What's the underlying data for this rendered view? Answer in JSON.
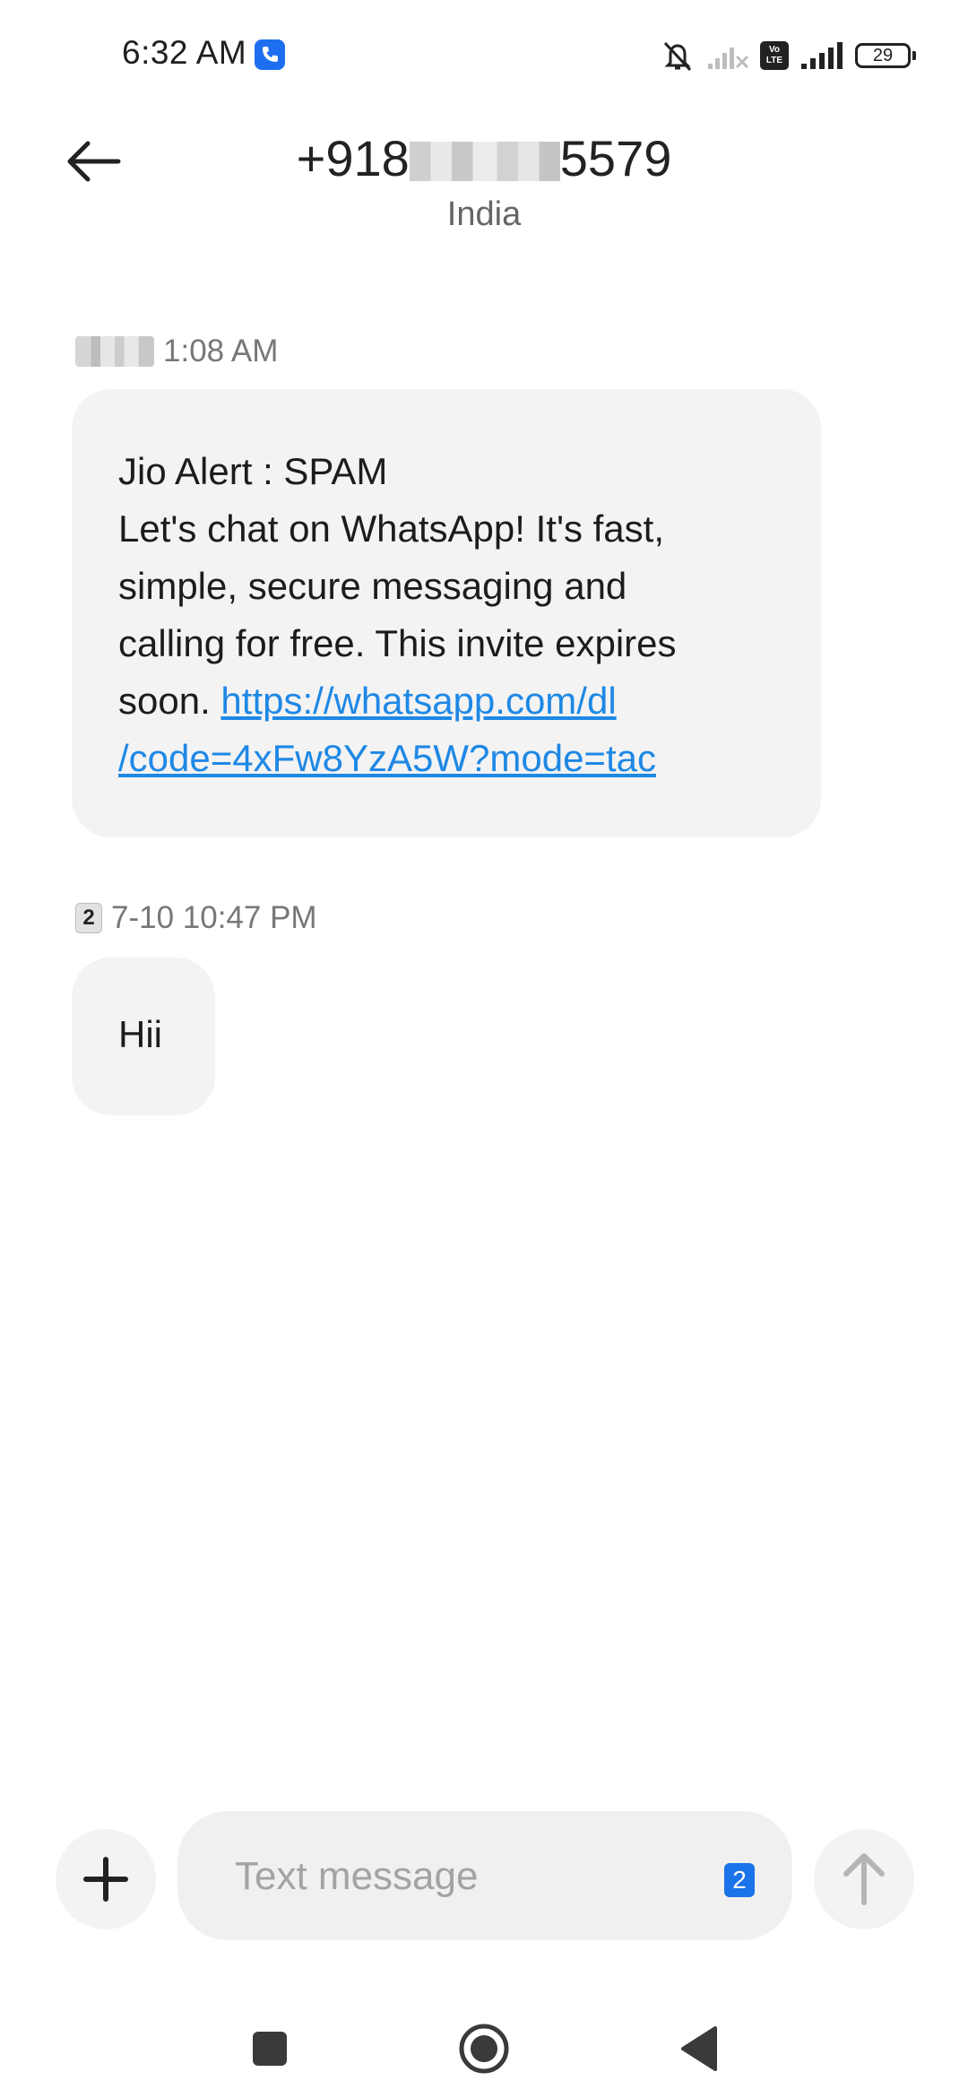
{
  "status_bar": {
    "time": "6:32 AM",
    "battery_level": "29",
    "volte_label_top": "Vo",
    "volte_label_bottom": "LTE",
    "icons": [
      "call-app-icon",
      "bell-muted-icon",
      "signal-no-service-icon",
      "volte-icon",
      "signal-icon",
      "battery-icon"
    ]
  },
  "header": {
    "back_icon": "arrow-left-icon",
    "title_prefix": "+918",
    "title_suffix": "5579",
    "subtitle": "India"
  },
  "messages": [
    {
      "timestamp": "1:08 AM",
      "sim_indicator": "blurred",
      "lines": [
        "Jio Alert : SPAM",
        "Let's chat on WhatsApp! It's fast,",
        "simple, secure messaging and",
        "calling for free. This invite expires"
      ],
      "link_lead": "soon. ",
      "link_line1": "https://whatsapp.com/dl",
      "link_line2": "/code=4xFw8YzA5W?mode=tac"
    },
    {
      "timestamp": "7-10 10:47 PM",
      "sim_indicator": "2",
      "text": "Hii"
    }
  ],
  "composer": {
    "attach_icon": "plus-icon",
    "placeholder": "Text message",
    "sim_label": "2",
    "send_icon": "arrow-up-icon"
  },
  "nav_bar": {
    "icons": [
      "recents-square-icon",
      "home-circle-icon",
      "back-triangle-icon"
    ]
  },
  "colors": {
    "link": "#1e88e5",
    "bubble": "#f3f3f3",
    "sim_badge": "#1a73e8"
  }
}
